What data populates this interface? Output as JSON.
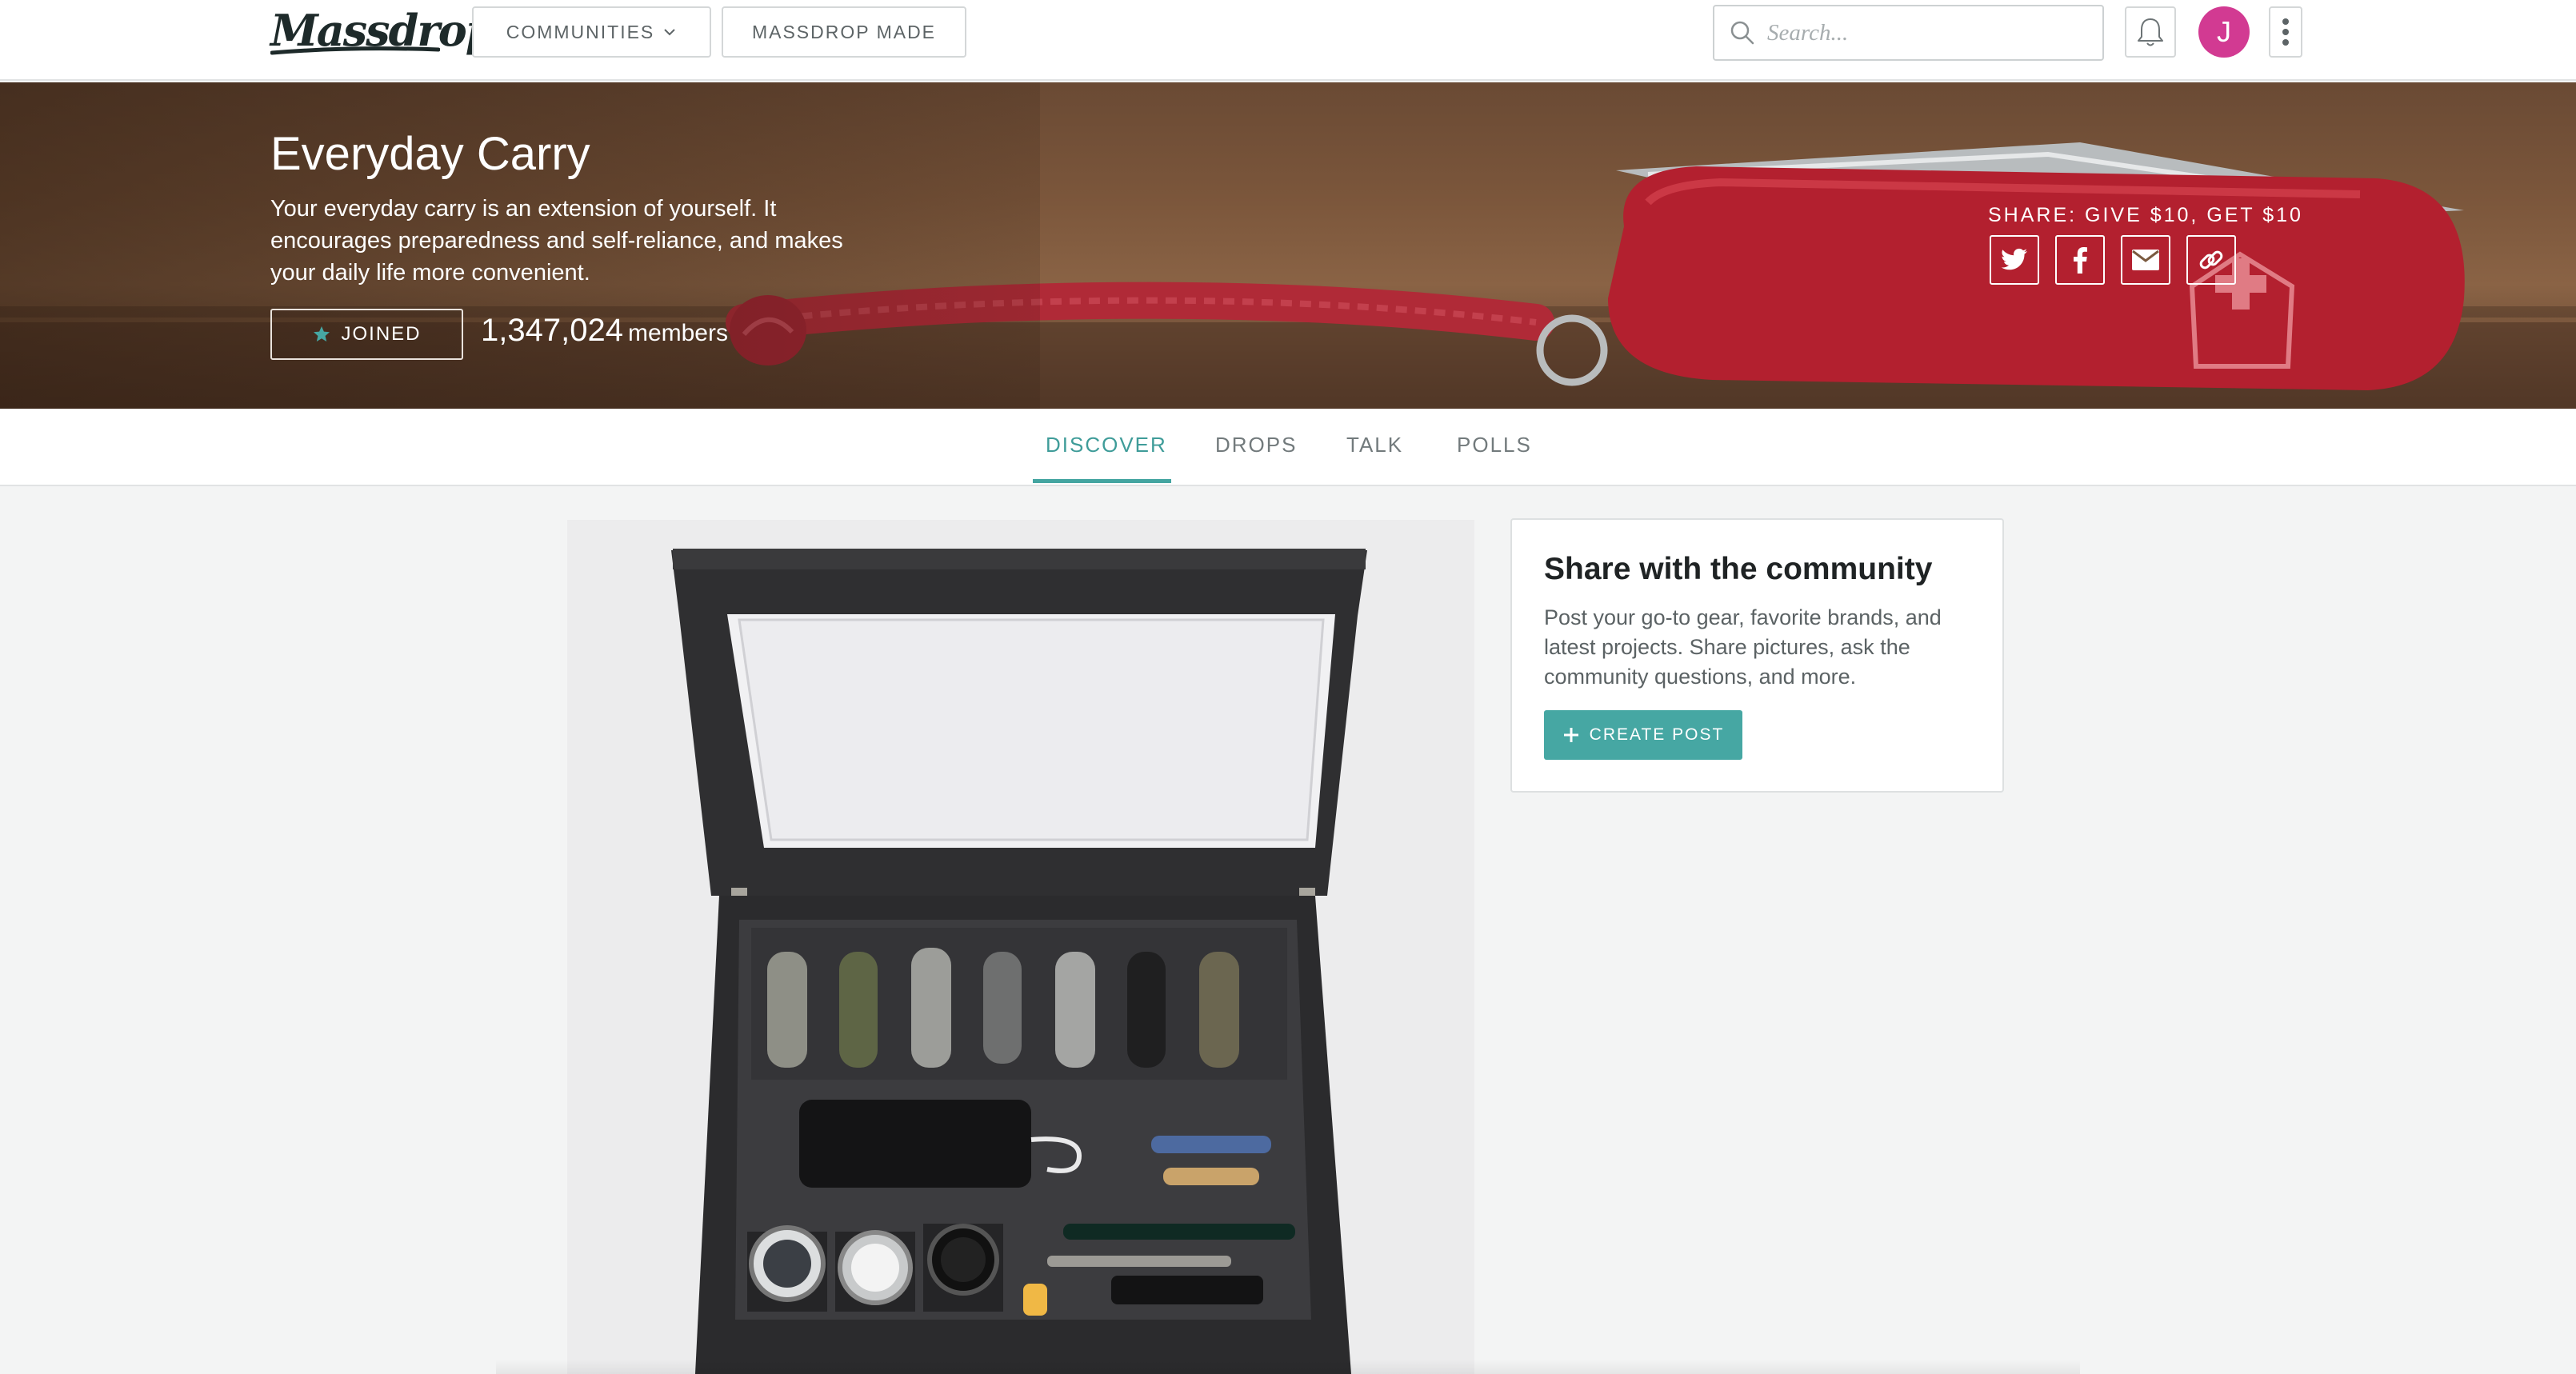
{
  "nav": {
    "logo": "Massdrop",
    "communities_label": "COMMUNITIES",
    "made_label": "MASSDROP MADE",
    "search_placeholder": "Search...",
    "avatar_initial": "J"
  },
  "hero": {
    "title": "Everyday Carry",
    "description": "Your everyday carry is an extension of yourself. It encourages preparedness and self-reliance, and makes your daily life more convenient.",
    "joined_label": "JOINED",
    "member_count": "1,347,024",
    "members_label": "members",
    "share_label": "SHARE: GIVE $10, GET $10",
    "share_icons": [
      "twitter-icon",
      "facebook-icon",
      "email-icon",
      "link-icon"
    ]
  },
  "tabs": [
    {
      "label": "DISCOVER",
      "active": true
    },
    {
      "label": "DROPS",
      "active": false
    },
    {
      "label": "TALK",
      "active": false
    },
    {
      "label": "POLLS",
      "active": false
    }
  ],
  "share_card": {
    "title": "Share with the community",
    "text": "Post your go-to gear, favorite brands, and latest projects. Share pictures, ask the community questions, and more.",
    "button_label": "CREATE POST"
  },
  "colors": {
    "accent": "#46a7a3",
    "avatar": "#d23a92",
    "hero_wood": "#7b563b",
    "knife_red": "#b3202f"
  }
}
